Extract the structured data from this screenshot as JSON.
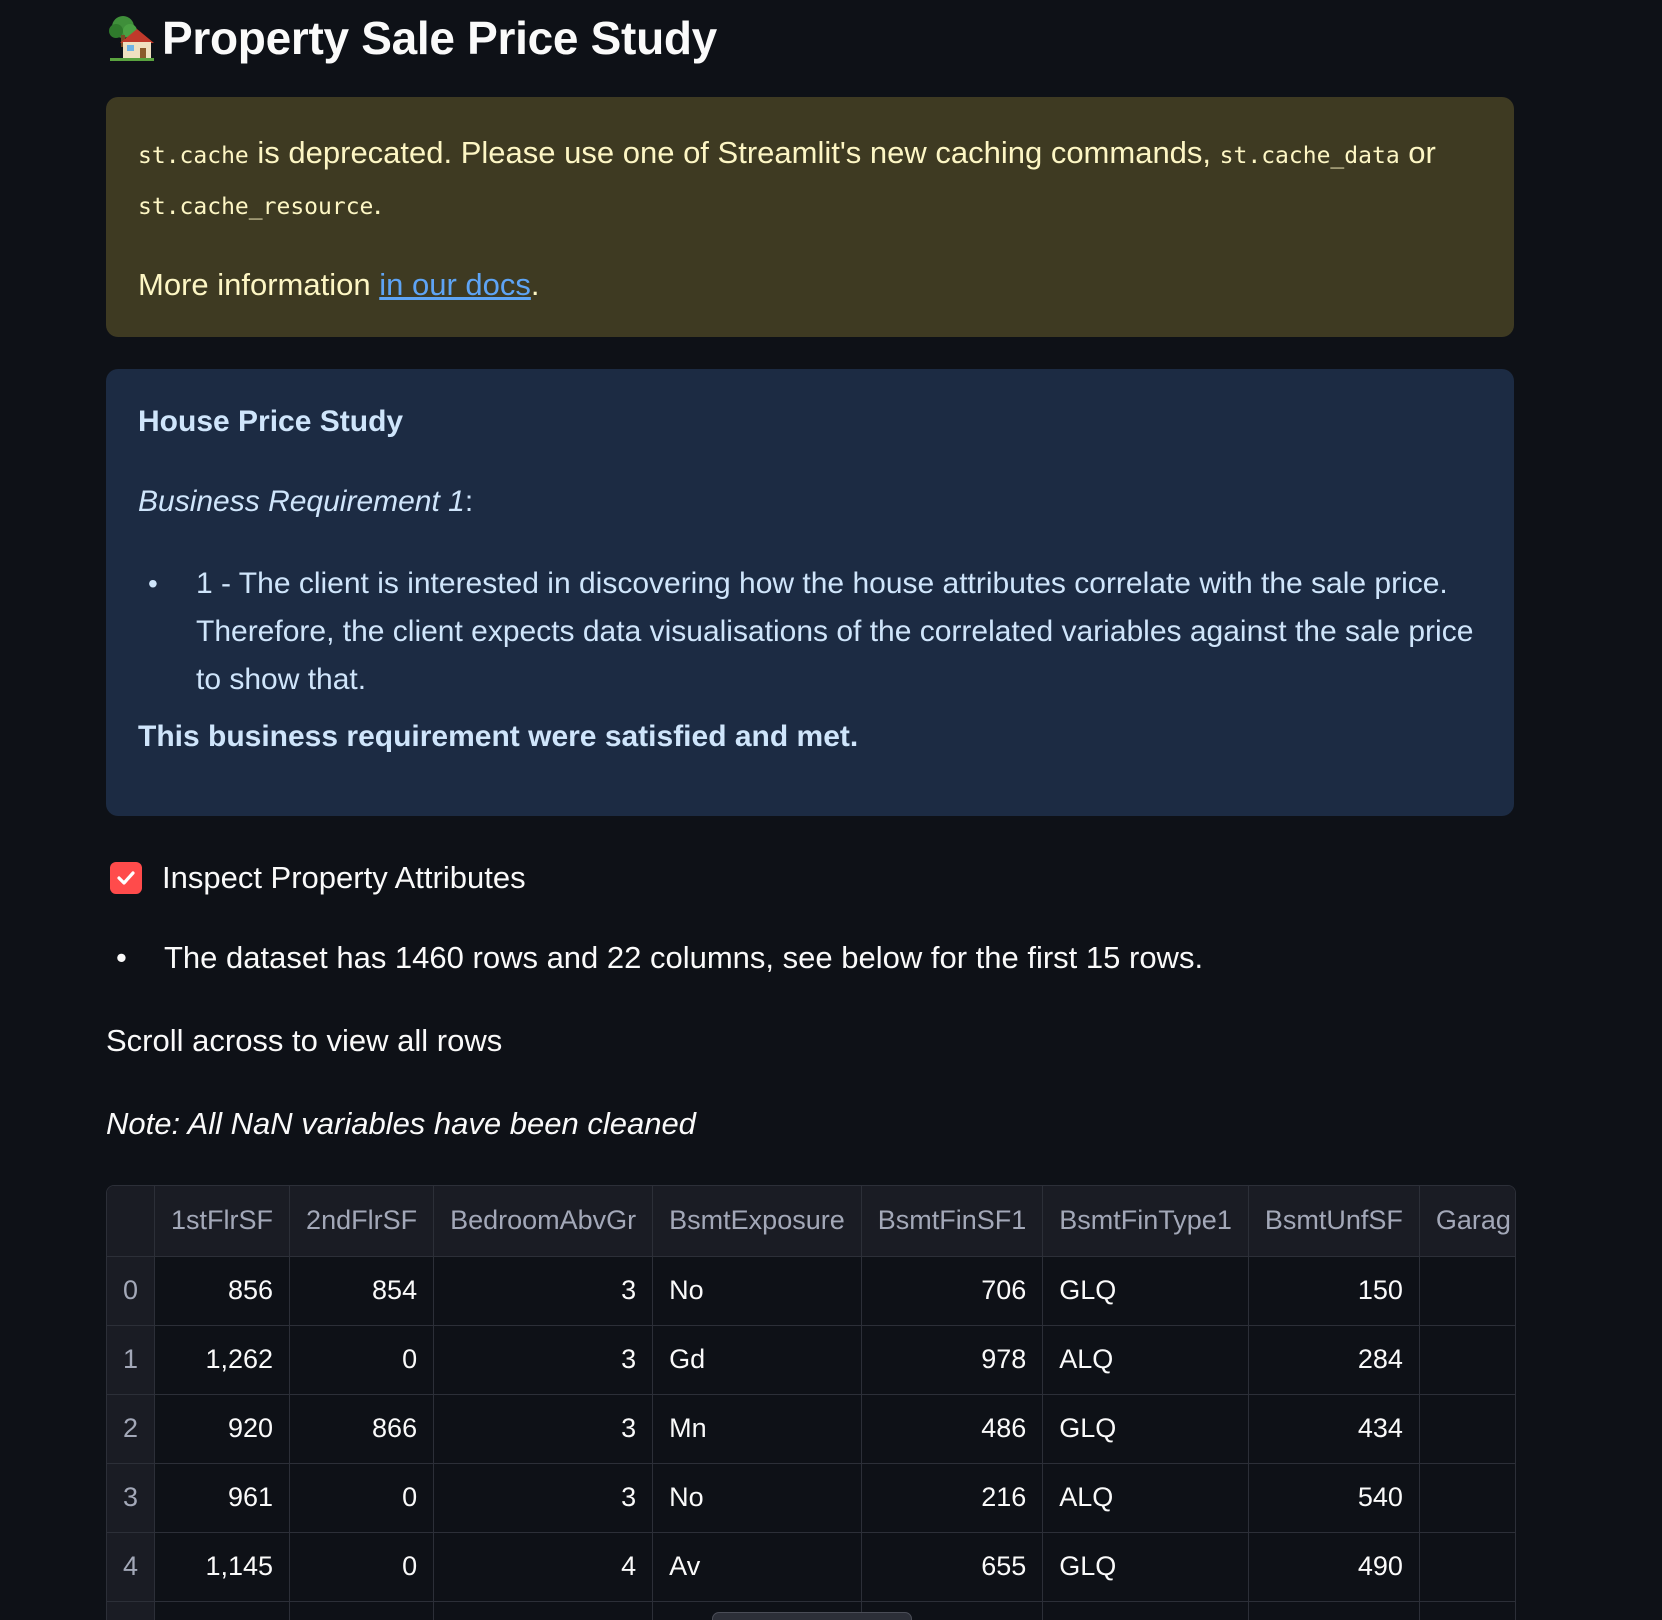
{
  "title": "Property Sale Price Study",
  "title_icon": "house-with-garden-icon",
  "warning": {
    "code1": "st.cache",
    "text1": " is deprecated. Please use one of Streamlit's new caching commands, ",
    "code2": "st.cache_data",
    "text2": " or ",
    "code3": "st.cache_resource",
    "text3": ".",
    "more_prefix": "More information ",
    "link_text": "in our docs",
    "more_suffix": "."
  },
  "info": {
    "heading": "House Price Study",
    "requirement_label": "Business Requirement 1",
    "requirement_colon": ":",
    "bullet": "1 - The client is interested in discovering how the house attributes correlate with the sale price. Therefore, the client expects data visualisations of the correlated variables against the sale price to show that.",
    "satisfied": "This business requirement were satisfied and met."
  },
  "checkbox": {
    "label": "Inspect Property Attributes",
    "checked": true
  },
  "dataset_bullet": "The dataset has 1460 rows and 22 columns, see below for the first 15 rows.",
  "scroll_text": "Scroll across to view all rows",
  "note": "Note: All NaN variables have been cleaned",
  "table": {
    "columns": [
      "",
      "1stFlrSF",
      "2ndFlrSF",
      "BedroomAbvGr",
      "BsmtExposure",
      "BsmtFinSF1",
      "BsmtFinType1",
      "BsmtUnfSF",
      "Garag"
    ],
    "rows": [
      [
        "0",
        "856",
        "854",
        "3",
        "No",
        "706",
        "GLQ",
        "150",
        ""
      ],
      [
        "1",
        "1,262",
        "0",
        "3",
        "Gd",
        "978",
        "ALQ",
        "284",
        ""
      ],
      [
        "2",
        "920",
        "866",
        "3",
        "Mn",
        "486",
        "GLQ",
        "434",
        ""
      ],
      [
        "3",
        "961",
        "0",
        "3",
        "No",
        "216",
        "ALQ",
        "540",
        ""
      ],
      [
        "4",
        "1,145",
        "0",
        "4",
        "Av",
        "655",
        "GLQ",
        "490",
        ""
      ]
    ]
  },
  "colors": {
    "background": "#0e1117",
    "warning_bg": "#3e3a22",
    "info_bg": "#1c2b43",
    "accent": "#ff4b4b",
    "link": "#5ea4f5"
  }
}
